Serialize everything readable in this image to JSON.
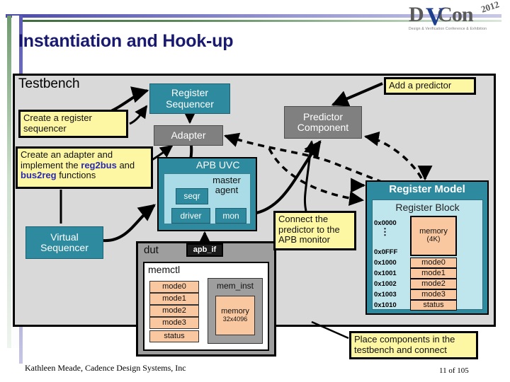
{
  "slide": {
    "title": "Instantiation and Hook-up",
    "footer_author": "Kathleen Meade, Cadence Design Systems, Inc",
    "footer_page": "11 of 105"
  },
  "logo": {
    "d": "D",
    "v": "V",
    "con": "Con",
    "year": "2012",
    "subtitle": "Design & Verification Conference & Exhibition"
  },
  "testbench": {
    "label": "Testbench",
    "register_sequencer": "Register Sequencer",
    "adapter": "Adapter",
    "predictor_component": "Predictor Component",
    "virtual_sequencer": "Virtual Sequencer"
  },
  "apb_uvc": {
    "label": "APB UVC",
    "master_agent": "master agent",
    "seqr": "seqr",
    "driver": "driver",
    "mon": "mon"
  },
  "dut": {
    "label": "dut",
    "apb_if": "apb_if",
    "memctl": "memctl",
    "registers": [
      "mode0",
      "mode1",
      "mode2",
      "mode3",
      "status"
    ],
    "mem_inst": "mem_inst",
    "memory_name": "memory",
    "memory_size": "32x4096"
  },
  "register_model": {
    "title": "Register Model",
    "block_title": "Register Block",
    "memory_name": "memory",
    "memory_size": "(4K)",
    "addresses": {
      "start": "0x0000",
      "dots": "⋮",
      "end": "0x0FFF",
      "mode0": "0x1000",
      "mode1": "0x1001",
      "mode2": "0x1002",
      "mode3": "0x1003",
      "status": "0x1010"
    },
    "registers": [
      "mode0",
      "mode1",
      "mode2",
      "mode3",
      "status"
    ]
  },
  "callouts": {
    "create_register_sequencer": "Create a register sequencer",
    "create_adapter_pre": "Create an adapter and implement the ",
    "create_adapter_kw1": "reg2bus",
    "create_adapter_mid": " and ",
    "create_adapter_kw2": "bus2reg",
    "create_adapter_post": " functions",
    "add_a_predictor": "Add a predictor",
    "connect_predictor": "Connect the predictor to the APB monitor",
    "place_components": "Place components in the testbench and connect"
  },
  "colors": {
    "title": "#191970",
    "teal": "#2e8a9e",
    "light_teal": "#a9dce6",
    "gray": "#808080",
    "peach": "#fac8a0",
    "callout_yellow": "#fdf7a3",
    "testbench_bg": "#d9d9d9"
  }
}
